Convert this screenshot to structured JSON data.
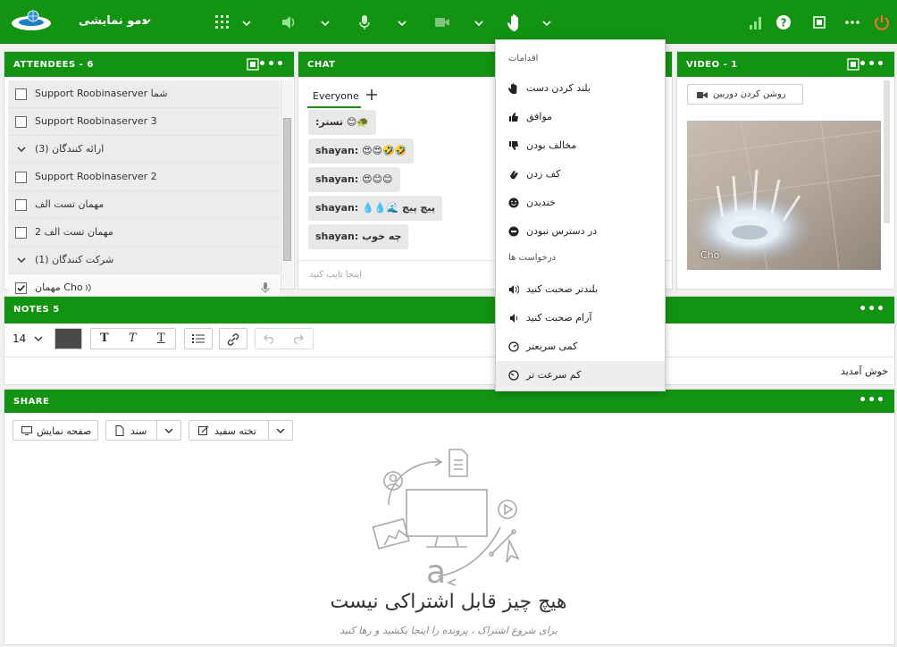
{
  "topbar": {
    "meeting_name": "دمو نمایشی",
    "icons": [
      "logo",
      "grid-icon",
      "speaker-icon",
      "microphone-icon",
      "camera-icon",
      "raise-hand-icon",
      "signal-icon",
      "help-icon",
      "fullscreen-icon",
      "more-icon",
      "power-icon"
    ]
  },
  "attendees": {
    "title": "ATTENDEES - 6",
    "rows": [
      {
        "type": "person",
        "name": "Support Roobinaserver شما",
        "checked": false
      },
      {
        "type": "person",
        "name": "Support Roobinaserver 3",
        "checked": false
      },
      {
        "type": "group",
        "name": "ارائه کنندگان (3)"
      },
      {
        "type": "person",
        "name": "Support Roobinaserver 2",
        "checked": false
      },
      {
        "type": "person",
        "name": "مهمان تست الف",
        "checked": false
      },
      {
        "type": "person",
        "name": "مهمان تست الف 2",
        "checked": false
      },
      {
        "type": "group",
        "name": "شرکت کنندگان (1)"
      },
      {
        "type": "person",
        "name": "مهمان Cho",
        "checked": true
      }
    ]
  },
  "chat": {
    "title": "CHAT",
    "tab": "Everyone",
    "messages": [
      {
        "text": ":تستر 😊🐢"
      },
      {
        "text": "shayan: 😍😍🤣🤣"
      },
      {
        "text": "shayan: 😍😊😊"
      },
      {
        "text": "shayan: 💧💧🌊 پیچ پیچ"
      },
      {
        "text": "shayan: چه خوب"
      }
    ],
    "placeholder": "اینجا تایپ کنید"
  },
  "video": {
    "title": "VIDEO - 1",
    "camera_button": "روشن کردن دوربین",
    "participant": "Cho"
  },
  "notes": {
    "title": "NOTES 5",
    "font_size": "14",
    "content": "خوش آمدید"
  },
  "share": {
    "title": "SHARE",
    "btn_screen": "صفحه نمایش",
    "btn_doc": "سند",
    "btn_whiteboard": "تخته سفید",
    "empty_title": "هیچ چیز قابل اشتراکی نیست",
    "empty_sub": "برای شروع اشتراک ، پرونده را اینجا بکشید و رها کنید"
  },
  "menu": {
    "section_actions": "اقدامات",
    "actions": [
      "بلند کردن دست",
      "موافق",
      "مخالف بودن",
      "کف زدن",
      "خندیدن",
      "در دسترس نبودن"
    ],
    "section_requests": "درخواست ها",
    "requests": [
      "بلندتر صحبت کنید",
      "آرام صحبت کنید",
      "کمی سریعتر",
      "کم سرعت تر"
    ]
  },
  "colors": {
    "header_green": "#129312",
    "power": "#ff6a3d",
    "signal": "#8fe28f"
  }
}
